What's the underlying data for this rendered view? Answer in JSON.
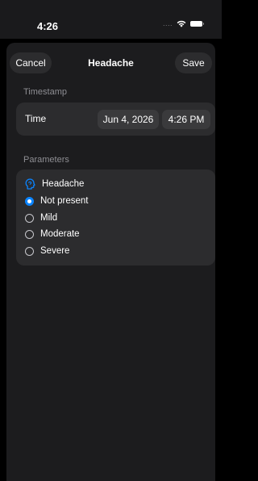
{
  "status_bar": {
    "time": "4:26",
    "signal": "....",
    "icons": [
      "wifi-icon",
      "battery-icon"
    ]
  },
  "nav": {
    "cancel_label": "Cancel",
    "title": "Headache",
    "save_label": "Save"
  },
  "timestamp_section": {
    "header": "Timestamp",
    "time_label": "Time",
    "date_value": "Jun 4, 2026",
    "time_value": "4:26 PM"
  },
  "parameters_section": {
    "header": "Parameters",
    "group_label": "Headache",
    "group_icon": "head-icon",
    "options": [
      {
        "label": "Not present",
        "selected": true
      },
      {
        "label": "Mild",
        "selected": false
      },
      {
        "label": "Moderate",
        "selected": false
      },
      {
        "label": "Severe",
        "selected": false
      }
    ]
  },
  "colors": {
    "accent": "#0a84ff",
    "background": "#000000",
    "sheet": "#1c1c1e",
    "card": "#2c2c2e",
    "secondary_text": "#8e8e93"
  }
}
